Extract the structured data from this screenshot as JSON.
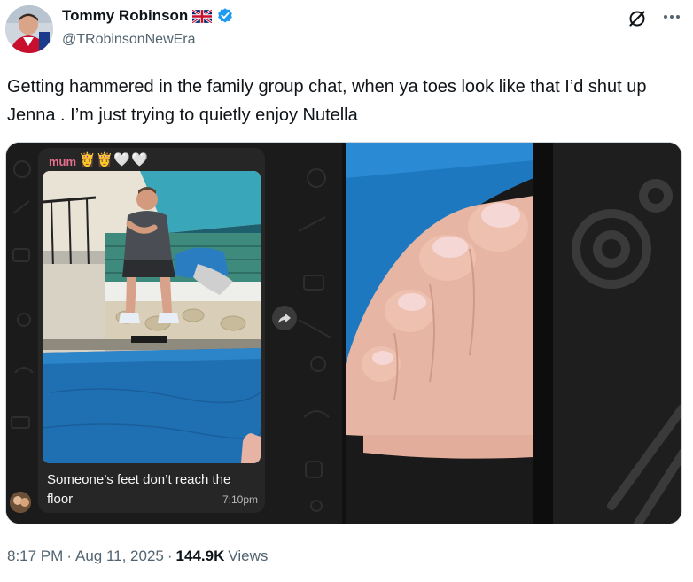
{
  "author": {
    "name": "Tommy Robinson",
    "flag_emoji": "🇬🇧",
    "handle": "@TRobinsonNewEra",
    "verified_icon": "verified-badge-icon"
  },
  "tweet": {
    "text": "Getting hammered in the family group chat, when ya toes look like that I’d shut up Jenna . I’m just trying to quietly enjoy Nutella"
  },
  "chat_message": {
    "sender": "mum",
    "sender_emojis": "👸👸🤍🤍",
    "caption": "Someone’s feet don’t reach the floor",
    "time": "7:10pm"
  },
  "footer": {
    "time": "8:17 PM",
    "separator": "·",
    "date": "Aug 11, 2025",
    "views_count": "144.9K",
    "views_label": "Views"
  },
  "colors": {
    "text_primary": "#0f1419",
    "text_secondary": "#536471",
    "verified_blue": "#1d9bf0",
    "sender_pink": "#e86f8c"
  }
}
